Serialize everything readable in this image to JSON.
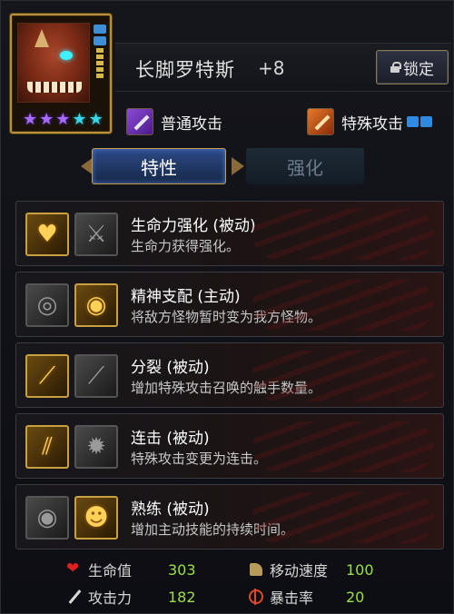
{
  "monster": {
    "name": "长脚罗特斯",
    "level": "+8",
    "stars": [
      "purple",
      "purple",
      "purple",
      "cyan",
      "cyan"
    ]
  },
  "header": {
    "lock_label": "锁定"
  },
  "attacks": {
    "normal_label": "普通攻击",
    "special_label": "特殊攻击"
  },
  "tabs": [
    {
      "label": "特性",
      "active": true
    },
    {
      "label": "强化",
      "active": false
    }
  ],
  "traits": [
    {
      "name": "生命力强化 (被动)",
      "desc": "生命力获得强化。",
      "icon1": "heart-body-icon",
      "icon2": "spikes-icon"
    },
    {
      "name": "精神支配 (主动)",
      "desc": "将敌方怪物暂时变为我方怪物。",
      "icon1": "swirl-icon",
      "icon2": "eye-icon"
    },
    {
      "name": "分裂 (被动)",
      "desc": "增加特殊攻击召唤的触手数量。",
      "icon1": "split-spear-icon",
      "icon2": "claw-icon"
    },
    {
      "name": "连击 (被动)",
      "desc": "特殊攻击变更为连击。",
      "icon1": "slash-icon",
      "icon2": "burst-icon"
    },
    {
      "name": "熟练 (被动)",
      "desc": "增加主动技能的持续时间。",
      "icon1": "tentacle-eye-icon",
      "icon2": "monster-face-icon"
    }
  ],
  "stats": {
    "hp": {
      "label": "生命值",
      "value": "303"
    },
    "atk": {
      "label": "攻击力",
      "value": "182"
    },
    "speed": {
      "label": "移动速度",
      "value": "100"
    },
    "crit": {
      "label": "暴击率",
      "value": "20"
    }
  },
  "colors": {
    "gold_border": "#c8a040",
    "tab_active": "#2c4a86",
    "stat_value": "#9ae04a"
  }
}
